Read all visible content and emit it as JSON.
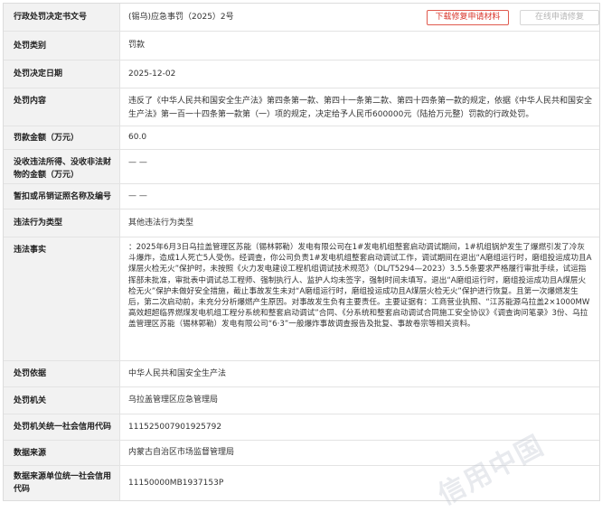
{
  "rows": [
    {
      "label": "行政处罚决定书文号",
      "value": "(锡乌)应急事罚（2025）2号"
    },
    {
      "label": "处罚类别",
      "value": "罚款"
    },
    {
      "label": "处罚决定日期",
      "value": "2025-12-02"
    },
    {
      "label": "处罚内容",
      "value": "违反了《中华人民共和国安全生产法》第四条第一款、第四十一条第二款、第四十四条第一款的规定，依据《中华人民共和国安全生产法》第一百一十四条第一款第（一）项的规定，决定给予人民币600000元（陆拾万元整）罚款的行政处罚。"
    },
    {
      "label": "罚款金额（万元）",
      "value": "60.0"
    },
    {
      "label": "没收违法所得、没收非法财物的金额（万元）",
      "value": "— —"
    },
    {
      "label": "暂扣或吊销证照名称及编号",
      "value": "— —"
    },
    {
      "label": "违法行为类型",
      "value": "其他违法行为类型"
    },
    {
      "label": "违法事实",
      "value": "：2025年6月3日乌拉盖管理区苏能（锡林郭勒）发电有限公司在1#发电机组整套启动调试期间，1#机组锅炉发生了爆燃引发了冷灰斗爆炸，造成1人死亡5人受伤。经调查，你公司负责1#发电机组整套启动调试工作，调试期间在退出“A磨组运行时，磨组投运成功且A煤层火检无火”保护时，未按照《火力发电建设工程机组调试技术规范》（DL/T5294—2023）3.5.5条要求严格履行审批手续，试运指挥部未批准，审批表中调试总工程师、强制执行人、监护人均未签字，强制时间未填写。退出“A磨组运行时，磨组投运成功且A煤层火检无火”保护未做好安全措施，截止事故发生未对“A磨组运行时，磨组投运成功且A煤层火检无火”保护进行恢复。且第一次爆燃发生后，第二次启动前，未充分分析爆燃产生原因。对事故发生负有主要责任。主要证据有：工商营业执照、“江苏能源乌拉盖2×1000MW高效超超临界燃煤发电机组工程分系统和整套启动调试”合同、《分系统和整套启动调试合同施工安全协议》《调查询问笔录》3份、乌拉盖管理区苏能（锡林郭勒）发电有限公司“6·3”一般爆炸事故调查报告及批复、事故卷宗等相关资料。"
    },
    {
      "label": "处罚依据",
      "value": "中华人民共和国安全生产法"
    },
    {
      "label": "处罚机关",
      "value": "乌拉盖管理区应急管理局"
    },
    {
      "label": "处罚机关统一社会信用代码",
      "value": "11152500790192579​2"
    },
    {
      "label": "数据来源",
      "value": "内蒙古自治区市场监督管理局"
    },
    {
      "label": "数据来源单位统一社会信用代码",
      "value": "11150000MB1937153P"
    }
  ],
  "buttons": {
    "download_repair": "下载修复申请材料",
    "online_repair": "在线申请修复"
  },
  "watermark": "信用中国"
}
